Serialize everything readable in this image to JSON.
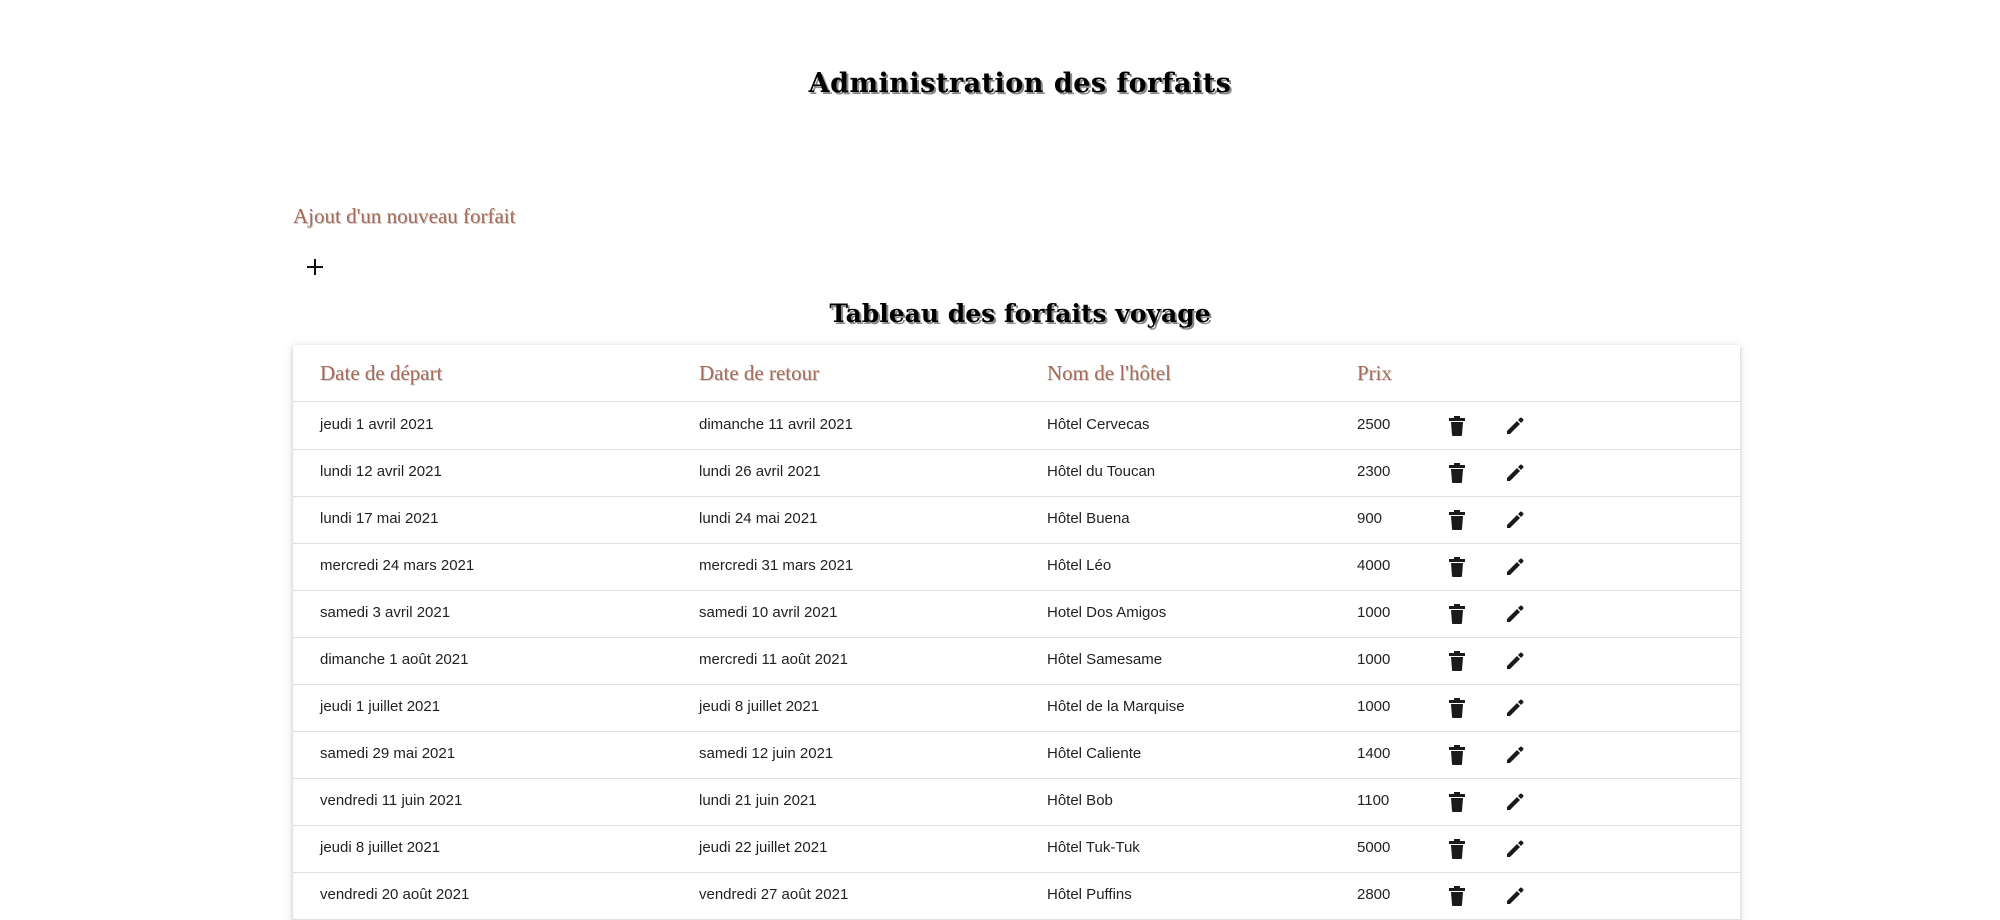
{
  "header": {
    "title": "Administration des forfaits"
  },
  "add_section": {
    "title": "Ajout d'un nouveau forfait",
    "add_icon": "plus-icon"
  },
  "table": {
    "title": "Tableau des forfaits voyage",
    "columns": [
      "Date de départ",
      "Date de retour",
      "Nom de l'hôtel",
      "Prix"
    ],
    "row_actions": {
      "delete_icon": "trash-icon",
      "edit_icon": "pencil-icon"
    },
    "rows": [
      {
        "depart": "jeudi 1 avril 2021",
        "retour": "dimanche 11 avril 2021",
        "hotel": "Hôtel Cervecas",
        "prix": "2500"
      },
      {
        "depart": "lundi 12 avril 2021",
        "retour": "lundi 26 avril 2021",
        "hotel": "Hôtel du Toucan",
        "prix": "2300"
      },
      {
        "depart": "lundi 17 mai 2021",
        "retour": "lundi 24 mai 2021",
        "hotel": "Hôtel Buena",
        "prix": "900"
      },
      {
        "depart": "mercredi 24 mars 2021",
        "retour": "mercredi 31 mars 2021",
        "hotel": "Hôtel Léo",
        "prix": "4000"
      },
      {
        "depart": "samedi 3 avril 2021",
        "retour": "samedi 10 avril 2021",
        "hotel": "Hotel Dos Amigos",
        "prix": "1000"
      },
      {
        "depart": "dimanche 1 août 2021",
        "retour": "mercredi 11 août 2021",
        "hotel": "Hôtel Samesame",
        "prix": "1000"
      },
      {
        "depart": "jeudi 1 juillet 2021",
        "retour": "jeudi 8 juillet 2021",
        "hotel": "Hôtel de la Marquise",
        "prix": "1000"
      },
      {
        "depart": "samedi 29 mai 2021",
        "retour": "samedi 12 juin 2021",
        "hotel": "Hôtel Caliente",
        "prix": "1400"
      },
      {
        "depart": "vendredi 11 juin 2021",
        "retour": "lundi 21 juin 2021",
        "hotel": "Hôtel Bob",
        "prix": "1100"
      },
      {
        "depart": "jeudi 8 juillet 2021",
        "retour": "jeudi 22 juillet 2021",
        "hotel": "Hôtel Tuk-Tuk",
        "prix": "5000"
      },
      {
        "depart": "vendredi 20 août 2021",
        "retour": "vendredi 27 août 2021",
        "hotel": "Hôtel Puffins",
        "prix": "2800"
      }
    ]
  },
  "colors": {
    "heading_accent": "#a66a57",
    "icon": "#1a1a1a",
    "divider": "#e0e0e0"
  }
}
